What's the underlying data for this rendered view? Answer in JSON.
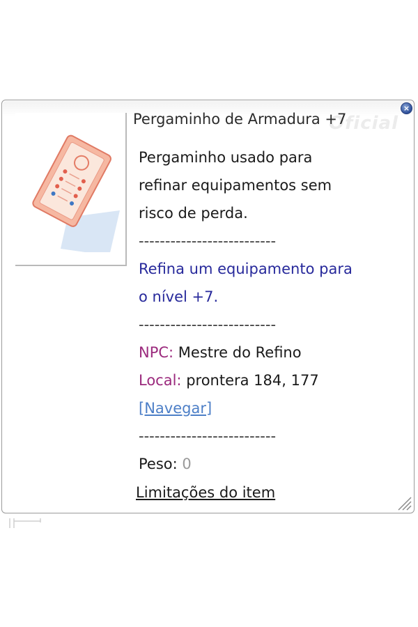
{
  "item": {
    "title": "Pergaminho de Armadura +7",
    "watermark": "Oficial",
    "description": [
      "Pergaminho usado para",
      "refinar equipamentos sem",
      "risco de perda."
    ],
    "separator": "--------------------------",
    "effect": [
      "Refina um equipamento para",
      "o nível +7."
    ],
    "npc_label": "NPC:",
    "npc_value": " Mestre do Refino",
    "local_label": "Local:",
    "local_value": " prontera 184, 177",
    "navigate_link": "[Navegar]",
    "weight_label": "Peso: ",
    "weight_value": "0",
    "limitations_link": "Limitações do item"
  },
  "icons": {
    "close": "close-icon",
    "item": "scroll-icon",
    "resize": "resize-grip-icon"
  },
  "colors": {
    "effect_text": "#27299b",
    "label_text": "#9b2a7d",
    "link_text": "#4d7fc7",
    "close_button": "#2d4f9a"
  }
}
